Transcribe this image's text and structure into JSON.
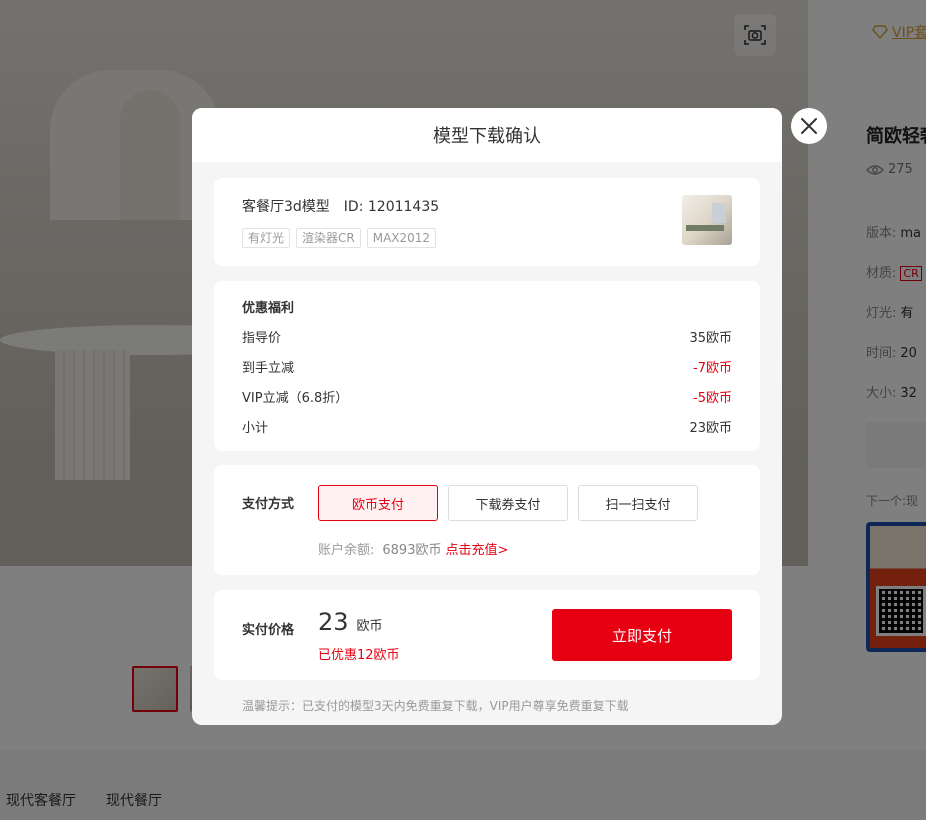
{
  "background": {
    "vip_link": "VIP套",
    "right_panel": {
      "title": "简欧轻奢",
      "views": "275",
      "rows": [
        {
          "label": "版本:",
          "value": "ma"
        },
        {
          "label": "材质:",
          "value": "CR"
        },
        {
          "label": "灯光:",
          "value": "有"
        },
        {
          "label": "时间:",
          "value": "20"
        },
        {
          "label": "大小:",
          "value": "32"
        }
      ],
      "next_label": "下一个:现"
    },
    "bottom_tags": [
      "现代客餐厅",
      "现代餐厅"
    ]
  },
  "modal": {
    "title": "模型下载确认",
    "model": {
      "name": "客餐厅3d模型",
      "id_text": "ID: 12011435",
      "tags": [
        "有灯光",
        "渲染器CR",
        "MAX2012"
      ]
    },
    "discount": {
      "heading": "优惠福利",
      "rows": [
        {
          "label": "指导价",
          "value": "35欧币",
          "highlight": false
        },
        {
          "label": "到手立减",
          "value": "-7欧币",
          "highlight": true
        },
        {
          "label": "VIP立减（6.8折）",
          "value": "-5欧币",
          "highlight": true
        },
        {
          "label": "小计",
          "value": "23欧币",
          "highlight": false
        }
      ]
    },
    "payment": {
      "label": "支付方式",
      "options": [
        "欧币支付",
        "下载券支付",
        "扫一扫支付"
      ],
      "selected_index": 0,
      "balance_label": "账户余额:",
      "balance_value": "6893欧币",
      "recharge_link": "点击充值>"
    },
    "total": {
      "label": "实付价格",
      "amount": "23",
      "unit": "欧币",
      "saved": "已优惠12欧币",
      "pay_button": "立即支付"
    },
    "tip": "温馨提示：已支付的模型3天内免费重复下载，VIP用户尊享免费重复下载"
  },
  "colors": {
    "accent_red": "#e60012",
    "vip_gold": "#d9a33a"
  },
  "icons": {
    "close": "close-icon",
    "camera": "camera-icon",
    "eye": "eye-icon",
    "vip": "vip-diamond-icon"
  }
}
